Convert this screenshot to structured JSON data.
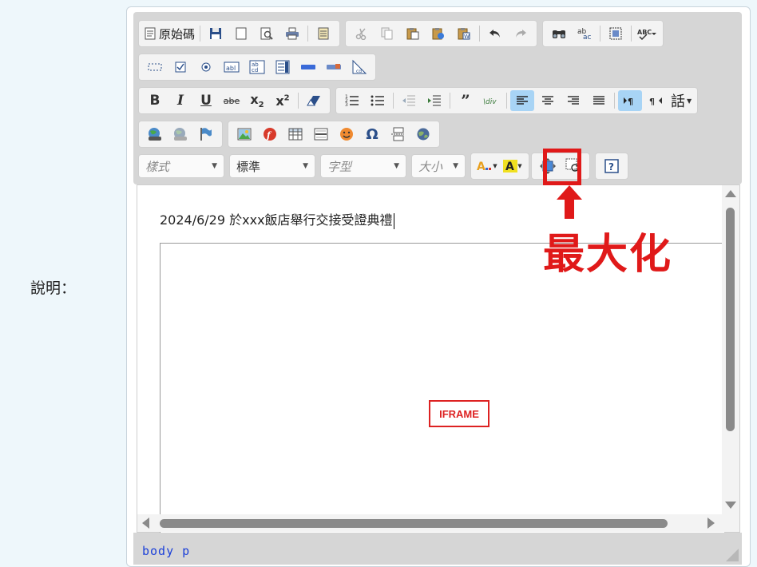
{
  "field": {
    "label": "說明："
  },
  "toolbar": {
    "source_label": "原始碼",
    "combos": {
      "styles": "樣式",
      "format": "標準",
      "font": "字型",
      "size": "大小"
    },
    "lang_label": "話"
  },
  "content": {
    "text": "2024/6/29 於xxx飯店舉行交接受證典禮",
    "iframe_label": "IFRAME"
  },
  "status": {
    "path": "body p"
  },
  "annotation": {
    "text": "最大化"
  },
  "colors": {
    "annotation_red": "#e01919",
    "path_blue": "#1a3fd8",
    "active_bg": "#a8d4f5"
  }
}
